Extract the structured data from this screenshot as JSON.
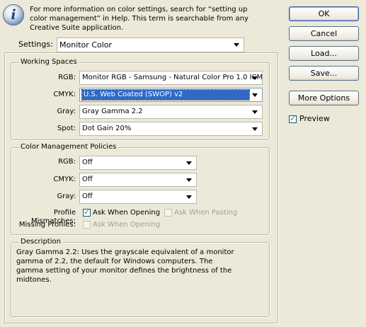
{
  "info": {
    "icon": "info-icon",
    "text": "For more information on color settings, search for “setting up color management” in Help. This term is searchable from any Creative Suite application."
  },
  "settings": {
    "label": "Settings:",
    "value": "Monitor Color"
  },
  "working_spaces": {
    "title": "Working Spaces",
    "rgb": {
      "label": "RGB:",
      "value": "Monitor RGB - Samsung - Natural Color Pro 1.0 ICM"
    },
    "cmyk": {
      "label": "CMYK:",
      "value": "U.S. Web Coated (SWOP) v2"
    },
    "gray": {
      "label": "Gray:",
      "value": "Gray Gamma 2.2"
    },
    "spot": {
      "label": "Spot:",
      "value": "Dot Gain 20%"
    }
  },
  "policies": {
    "title": "Color Management Policies",
    "rgb": {
      "label": "RGB:",
      "value": "Off"
    },
    "cmyk": {
      "label": "CMYK:",
      "value": "Off"
    },
    "gray": {
      "label": "Gray:",
      "value": "Off"
    },
    "profile_mismatches": {
      "label": "Profile Mismatches:",
      "ask_opening": {
        "label": "Ask When Opening",
        "checked": true
      },
      "ask_pasting": {
        "label": "Ask When Pasting",
        "checked": false,
        "disabled": true
      }
    },
    "missing_profiles": {
      "label": "Missing Profiles:",
      "ask_opening": {
        "label": "Ask When Opening",
        "checked": false,
        "disabled": true
      }
    }
  },
  "description": {
    "title": "Description",
    "text": "Gray Gamma 2.2:  Uses the grayscale equivalent of a monitor gamma of 2.2, the default for Windows computers.  The gamma setting of your monitor defines the brightness of the midtones."
  },
  "buttons": {
    "ok": "OK",
    "cancel": "Cancel",
    "load": "Load...",
    "save": "Save...",
    "more_options": "More Options"
  },
  "preview": {
    "label": "Preview",
    "checked": true
  }
}
